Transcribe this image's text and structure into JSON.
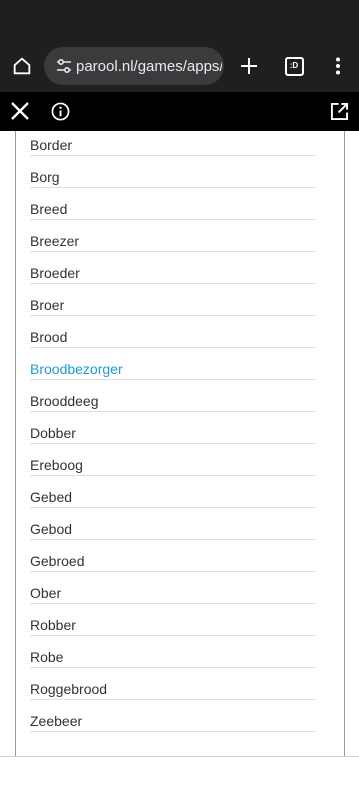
{
  "browser": {
    "url": "parool.nl/games/apps/",
    "tab_count": ":D",
    "icons": {
      "home": "home-icon",
      "site_settings": "tune-icon",
      "new_tab": "plus-icon",
      "tabs": "tab-switcher-icon",
      "menu": "more-vert-icon"
    }
  },
  "appbar": {
    "icons": {
      "close": "close-icon",
      "info": "info-icon",
      "external": "open-in-new-icon"
    }
  },
  "words": [
    {
      "text": "Border"
    },
    {
      "text": "Borg"
    },
    {
      "text": "Breed"
    },
    {
      "text": "Breezer"
    },
    {
      "text": "Broeder"
    },
    {
      "text": "Broer"
    },
    {
      "text": "Brood"
    },
    {
      "text": "Broodbezorger",
      "highlighted": true
    },
    {
      "text": "Brooddeeg"
    },
    {
      "text": "Dobber"
    },
    {
      "text": "Ereboog"
    },
    {
      "text": "Gebed"
    },
    {
      "text": "Gebod"
    },
    {
      "text": "Gebroed"
    },
    {
      "text": "Ober"
    },
    {
      "text": "Robber"
    },
    {
      "text": "Robe"
    },
    {
      "text": "Roggebrood"
    },
    {
      "text": "Zeebeer"
    }
  ],
  "colors": {
    "chrome": "#1f1f1f",
    "appbar": "#000000",
    "text": "#333333",
    "highlight": "#1e9bd6"
  }
}
